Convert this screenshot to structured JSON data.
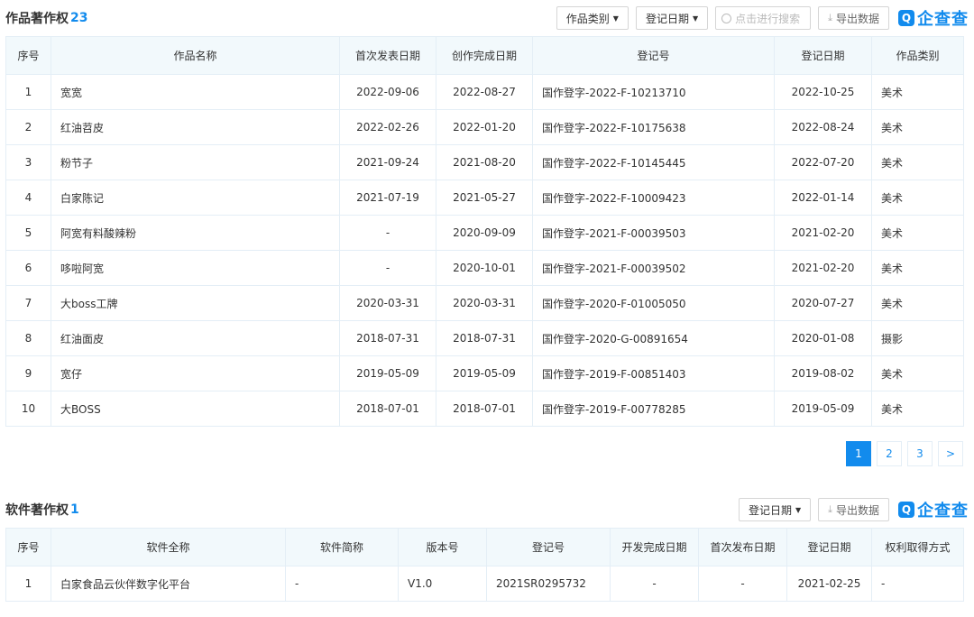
{
  "works": {
    "title": "作品著作权",
    "count": "23",
    "filter_category": "作品类别",
    "filter_date": "登记日期",
    "search_placeholder": "点击进行搜索",
    "export": "导出数据",
    "brand": "企查查",
    "columns": [
      "序号",
      "作品名称",
      "首次发表日期",
      "创作完成日期",
      "登记号",
      "登记日期",
      "作品类别"
    ],
    "rows": [
      [
        "1",
        "宽宽",
        "2022-09-06",
        "2022-08-27",
        "国作登字-2022-F-10213710",
        "2022-10-25",
        "美术"
      ],
      [
        "2",
        "红油苕皮",
        "2022-02-26",
        "2022-01-20",
        "国作登字-2022-F-10175638",
        "2022-08-24",
        "美术"
      ],
      [
        "3",
        "粉节子",
        "2021-09-24",
        "2021-08-20",
        "国作登字-2022-F-10145445",
        "2022-07-20",
        "美术"
      ],
      [
        "4",
        "白家陈记",
        "2021-07-19",
        "2021-05-27",
        "国作登字-2022-F-10009423",
        "2022-01-14",
        "美术"
      ],
      [
        "5",
        "阿宽有料酸辣粉",
        "-",
        "2020-09-09",
        "国作登字-2021-F-00039503",
        "2021-02-20",
        "美术"
      ],
      [
        "6",
        "哆啦阿宽",
        "-",
        "2020-10-01",
        "国作登字-2021-F-00039502",
        "2021-02-20",
        "美术"
      ],
      [
        "7",
        "大boss工牌",
        "2020-03-31",
        "2020-03-31",
        "国作登字-2020-F-01005050",
        "2020-07-27",
        "美术"
      ],
      [
        "8",
        "红油面皮",
        "2018-07-31",
        "2018-07-31",
        "国作登字-2020-G-00891654",
        "2020-01-08",
        "摄影"
      ],
      [
        "9",
        "宽仔",
        "2019-05-09",
        "2019-05-09",
        "国作登字-2019-F-00851403",
        "2019-08-02",
        "美术"
      ],
      [
        "10",
        "大BOSS",
        "2018-07-01",
        "2018-07-01",
        "国作登字-2019-F-00778285",
        "2019-05-09",
        "美术"
      ]
    ],
    "pages": [
      "1",
      "2",
      "3",
      ">"
    ]
  },
  "software": {
    "title": "软件著作权",
    "count": "1",
    "filter_date": "登记日期",
    "export": "导出数据",
    "brand": "企查查",
    "columns": [
      "序号",
      "软件全称",
      "软件简称",
      "版本号",
      "登记号",
      "开发完成日期",
      "首次发布日期",
      "登记日期",
      "权利取得方式"
    ],
    "rows": [
      [
        "1",
        "白家食品云伙伴数字化平台",
        "-",
        "V1.0",
        "2021SR0295732",
        "-",
        "-",
        "2021-02-25",
        "-"
      ]
    ]
  },
  "colors": {
    "accent": "#128bed",
    "header_bg": "#f2f9fc",
    "border": "#e4eef6"
  }
}
